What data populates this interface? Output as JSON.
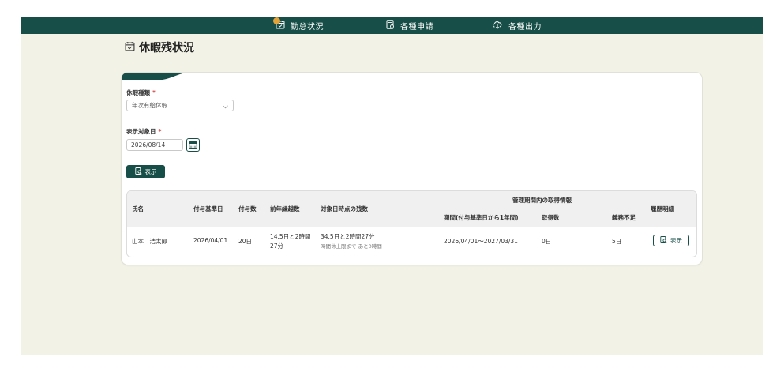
{
  "nav": {
    "items": [
      {
        "label": "勤怠状況",
        "icon": "calendar-icon"
      },
      {
        "label": "各種申請",
        "icon": "document-icon"
      },
      {
        "label": "各種出力",
        "icon": "cloud-download-icon"
      }
    ]
  },
  "page": {
    "title": "休暇残状況",
    "title_icon": "calendar-icon"
  },
  "form": {
    "leave_type": {
      "label": "休暇種類",
      "required_mark": "*",
      "value": "年次有給休暇"
    },
    "target_date": {
      "label": "表示対象日",
      "required_mark": "*",
      "value": "2026/08/14"
    },
    "show_button": "表示"
  },
  "table": {
    "headers": {
      "name": "氏名",
      "grant_base_date": "付与基準日",
      "grant_count": "付与数",
      "carryover": "前年繰越数",
      "remaining": "対象日時点の残数",
      "group": "管理期間内の取得情報",
      "period": "期間(付与基準日から1年間)",
      "acquired": "取得数",
      "shortfall": "義務不足",
      "history": "履歴明細"
    },
    "rows": [
      {
        "name": "山本　浩太郎",
        "grant_base_date": "2026/04/01",
        "grant_count": "20日",
        "carryover_line1": "14.5日と2時間",
        "carryover_line2": "27分",
        "remaining": "34.5日と2時間27分",
        "remaining_note": "時間休上限まで あと0時間",
        "period": "2026/04/01〜2027/03/31",
        "acquired": "0日",
        "shortfall": "5日",
        "history_button": "表示"
      }
    ]
  },
  "colors": {
    "primary": "#174e47",
    "background": "#f3f2e6",
    "required": "#d63a3a",
    "accent": "#e2a33a"
  }
}
